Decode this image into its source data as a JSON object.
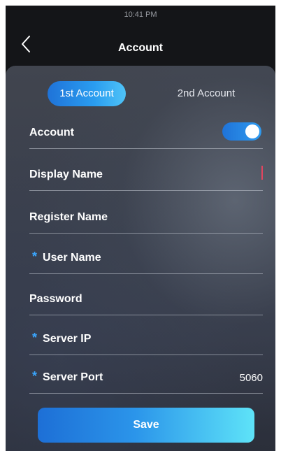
{
  "status_bar": {
    "time": "10:41 PM"
  },
  "header": {
    "title": "Account",
    "back_icon": "chevron-left-icon"
  },
  "tabs": [
    {
      "label": "1st Account",
      "active": true
    },
    {
      "label": "2nd Account",
      "active": false
    }
  ],
  "fields": {
    "account": {
      "label": "Account",
      "enabled": true
    },
    "display_name": {
      "label": "Display Name",
      "value": ""
    },
    "register_name": {
      "label": "Register Name",
      "value": ""
    },
    "user_name": {
      "label": "User Name",
      "required_mark": "*",
      "value": ""
    },
    "password": {
      "label": "Password",
      "value": ""
    },
    "server_ip": {
      "label": "Server IP",
      "required_mark": "*",
      "value": ""
    },
    "server_port": {
      "label": "Server Port",
      "required_mark": "*",
      "value": "5060"
    }
  },
  "save_button": {
    "label": "Save"
  },
  "colors": {
    "accent": "#2a9df0",
    "required": "#3aa7ff",
    "cursor": "#e3455f"
  }
}
